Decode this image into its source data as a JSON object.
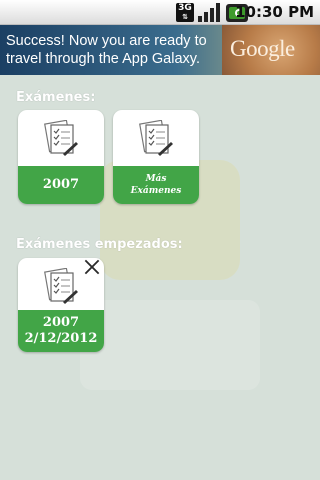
{
  "status_bar": {
    "network_label": "3G",
    "time": "10:30 PM"
  },
  "ad": {
    "text": "Success! Now you are ready to\ntravel through the App Galaxy.",
    "logo_text": "Google"
  },
  "sections": {
    "exams_label": "Exámenes:",
    "started_label": "Exámenes empezados:"
  },
  "tiles": {
    "exam_2007": {
      "label": "2007"
    },
    "more_exams": {
      "line1": "Más",
      "line2": "Exámenes"
    },
    "started_exam": {
      "line1": "2007",
      "line2": "2/12/2012"
    }
  },
  "colors": {
    "tile_green": "#42a547",
    "background": "#d6e0d9",
    "label_text": "#ffffff"
  },
  "icons": {
    "document": "document-checklist-icon",
    "delete": "close-icon"
  }
}
